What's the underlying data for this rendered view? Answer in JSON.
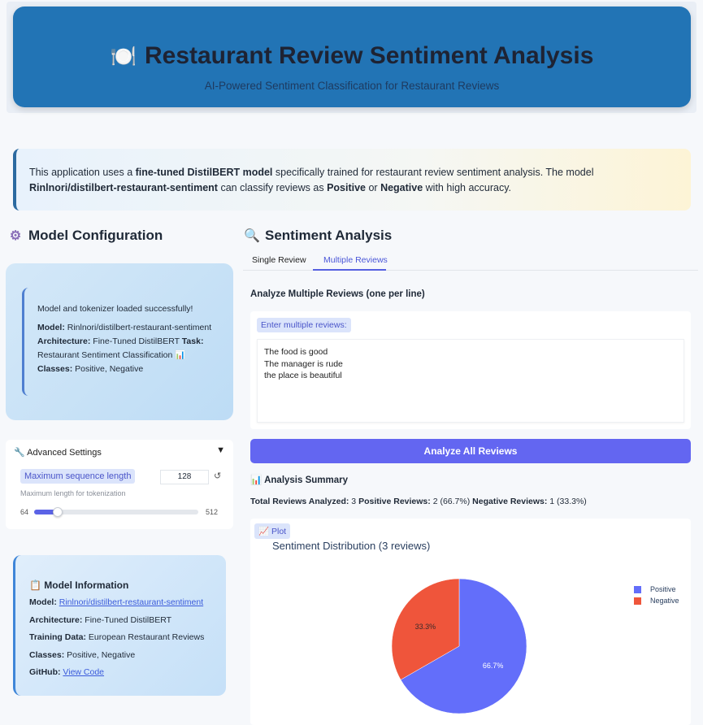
{
  "header": {
    "icon": "🍽️",
    "title": "Restaurant Review Sentiment Analysis",
    "subtitle": "AI-Powered Sentiment Classification for Restaurant Reviews"
  },
  "intro": {
    "t1": "This application uses a ",
    "b1": "fine-tuned DistilBERT model",
    "t2": " specifically trained for restaurant review sentiment analysis. The model ",
    "b2": "Rinlnori/distilbert-restaurant-sentiment",
    "t3": " can classify reviews as ",
    "b3": "Positive",
    "t4": " or ",
    "b4": "Negative",
    "t5": " with high accuracy."
  },
  "config": {
    "title": "Model Configuration",
    "status_loaded": "Model and tokenizer loaded successfully!",
    "model_label": "Model:",
    "model_value": " Rinlnori/distilbert-restaurant-sentiment ",
    "arch_label": "Architecture:",
    "arch_value": " Fine-Tuned DistilBERT ",
    "task_label": "Task:",
    "task_value": " Restaurant Sentiment Classification 📊 ",
    "classes_label": "Classes:",
    "classes_value": " Positive, Negative"
  },
  "advanced": {
    "title": "Advanced Settings",
    "toggle": "▼",
    "seq_label": "Maximum sequence length",
    "seq_value": "128",
    "reset": "↺",
    "hint": "Maximum length for tokenization",
    "min": "64",
    "max": "512",
    "min_value": 64,
    "max_value": 512,
    "current": 128
  },
  "model_info": {
    "title": "📋 Model Information",
    "model_label": "Model:",
    "model_link": "Rinlnori/distilbert-restaurant-sentiment",
    "arch_label": "Architecture:",
    "arch_value": " Fine-Tuned DistilBERT",
    "training_label": "Training Data:",
    "training_value": " European Restaurant Reviews",
    "classes_label": "Classes:",
    "classes_value": " Positive, Negative",
    "github_label": "GitHub:",
    "github_link": "View Code"
  },
  "analysis": {
    "title": "Sentiment Analysis",
    "tabs": [
      "Single Review",
      "Multiple Reviews"
    ],
    "heading": "Analyze Multiple Reviews (one per line)",
    "input_label": "Enter multiple reviews:",
    "input_value": "The food is good\nThe manager is rude\nthe place is beautiful",
    "button": "Analyze All Reviews",
    "summary_title": "📊 Analysis Summary",
    "total_label": "Total Reviews Analyzed:",
    "total_value": " 3 ",
    "pos_label": "Positive Reviews:",
    "pos_value": " 2 (66.7%) ",
    "neg_label": "Negative Reviews:",
    "neg_value": " 1 (33.3%)",
    "plot_label": "Plot"
  },
  "chart_data": {
    "type": "pie",
    "title": "Sentiment Distribution (3 reviews)",
    "labels": [
      "Positive",
      "Negative"
    ],
    "values": [
      66.7,
      33.3
    ],
    "colors": [
      "#636efa",
      "#ef553b"
    ],
    "legend": "top-right"
  }
}
